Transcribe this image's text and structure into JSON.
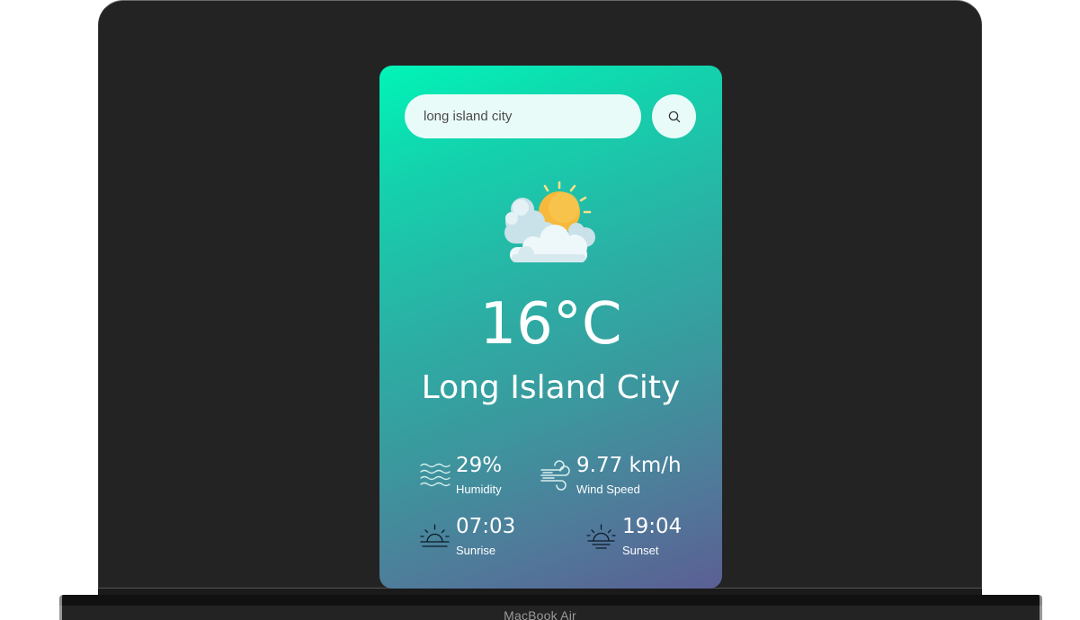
{
  "device": {
    "label": "MacBook Air"
  },
  "search": {
    "value": "long island city",
    "button_icon": "search-icon"
  },
  "weather": {
    "condition_icon": "partly-cloudy-icon",
    "temperature": "16°C",
    "city": "Long Island City"
  },
  "stats": {
    "humidity": {
      "value": "29%",
      "label": "Humidity",
      "icon": "humidity-waves-icon"
    },
    "wind": {
      "value": "9.77 km/h",
      "label": "Wind Speed",
      "icon": "wind-icon"
    },
    "sunrise": {
      "value": "07:03",
      "label": "Sunrise",
      "icon": "sunrise-icon"
    },
    "sunset": {
      "value": "19:04",
      "label": "Sunset",
      "icon": "sunset-icon"
    }
  },
  "colors": {
    "card_gradient_start": "#00f5b8",
    "card_gradient_end": "#5b5f94",
    "input_background": "#e9fbf9",
    "laptop_frame": "#232323"
  }
}
